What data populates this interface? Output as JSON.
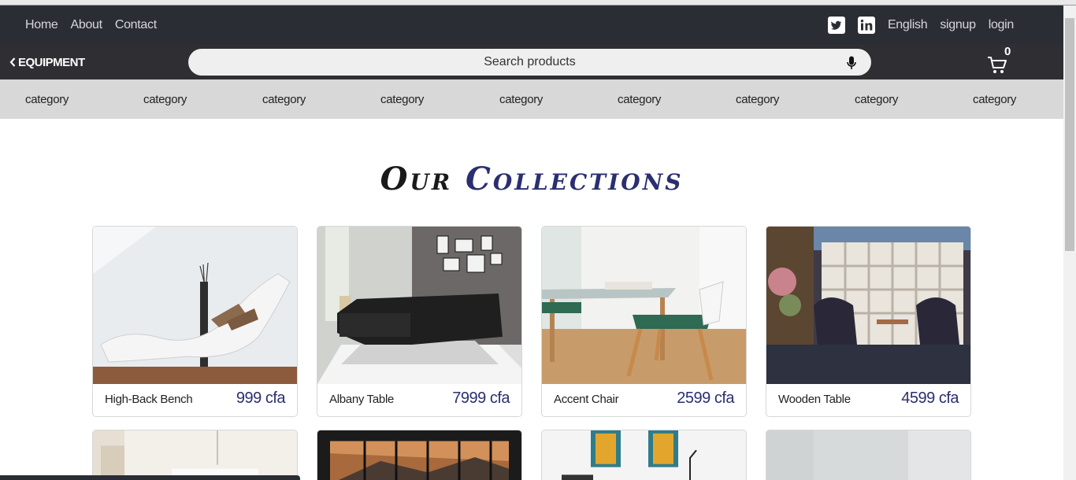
{
  "topnav": {
    "home": "Home",
    "about": "About",
    "contact": "Contact"
  },
  "topright": {
    "language": "English",
    "signup": "signup",
    "login": "login"
  },
  "searchbar": {
    "back_label": "EQUIPMENT",
    "placeholder": "Search products",
    "cart_count": "0"
  },
  "categories": [
    "category",
    "category",
    "category",
    "category",
    "category",
    "category",
    "category",
    "category",
    "category"
  ],
  "heading": {
    "word1": "Our",
    "word2": "Collections"
  },
  "products": [
    {
      "name": "High-Back Bench",
      "price": "999 cfa"
    },
    {
      "name": "Albany Table",
      "price": "7999 cfa"
    },
    {
      "name": "Accent Chair",
      "price": "2599 cfa"
    },
    {
      "name": "Wooden Table",
      "price": "4599 cfa"
    }
  ],
  "colors": {
    "topbar": "#2b2d35",
    "accent": "#2b2f70",
    "catbar": "#d8d8d8"
  },
  "icons": [
    "chevron-left-icon",
    "twitter-icon",
    "linkedin-icon",
    "microphone-icon",
    "cart-icon"
  ]
}
